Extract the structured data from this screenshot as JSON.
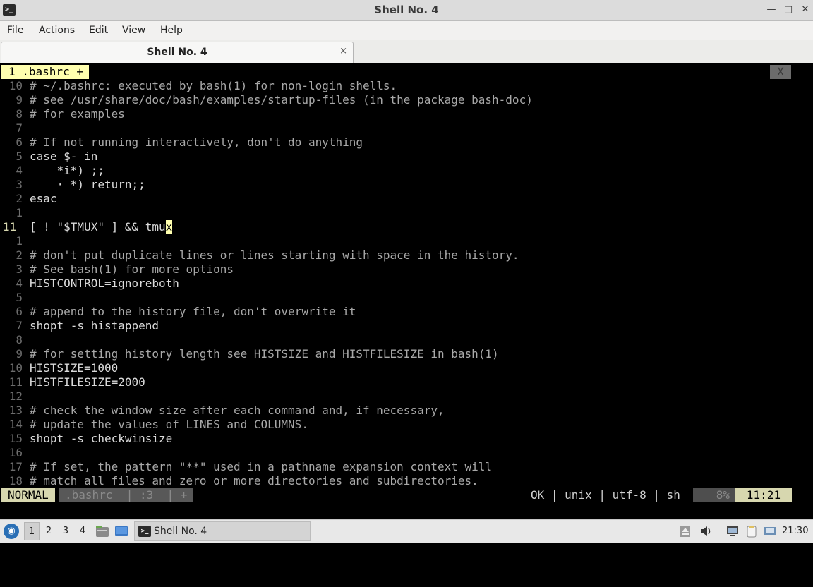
{
  "window": {
    "title": "Shell No. 4",
    "controls": {
      "minimize": "—",
      "maximize": "□",
      "close": "✕"
    }
  },
  "menu": [
    "File",
    "Actions",
    "Edit",
    "View",
    "Help"
  ],
  "tab": {
    "label": "Shell No. 4",
    "close": "×"
  },
  "editor": {
    "buffer_tab": "1 .bashrc +",
    "close_button": "X",
    "lines": [
      {
        "num": "10",
        "text": "# ~/.bashrc: executed by bash(1) for non-login shells.",
        "kind": "comment"
      },
      {
        "num": "9",
        "text": "# see /usr/share/doc/bash/examples/startup-files (in the package bash-doc)",
        "kind": "comment"
      },
      {
        "num": "8",
        "text": "# for examples",
        "kind": "comment"
      },
      {
        "num": "7",
        "text": "",
        "kind": "plain"
      },
      {
        "num": "6",
        "text": "# If not running interactively, don't do anything",
        "kind": "comment"
      },
      {
        "num": "5",
        "text": "case $- in",
        "kind": "plain"
      },
      {
        "num": "4",
        "text": "    *i*) ;;",
        "kind": "plain"
      },
      {
        "num": "3",
        "text": "    · *) return;;",
        "kind": "plain"
      },
      {
        "num": "2",
        "text": "esac",
        "kind": "plain"
      },
      {
        "num": "1",
        "text": "",
        "kind": "plain"
      },
      {
        "num": "11",
        "text": "[ ! \"$TMUX\" ] && tmu",
        "kind": "current",
        "cursor_char": "x"
      },
      {
        "num": "1",
        "text": "",
        "kind": "plain"
      },
      {
        "num": "2",
        "text": "# don't put duplicate lines or lines starting with space in the history.",
        "kind": "comment"
      },
      {
        "num": "3",
        "text": "# See bash(1) for more options",
        "kind": "comment"
      },
      {
        "num": "4",
        "text": "HISTCONTROL=ignoreboth",
        "kind": "plain"
      },
      {
        "num": "5",
        "text": "",
        "kind": "plain"
      },
      {
        "num": "6",
        "text": "# append to the history file, don't overwrite it",
        "kind": "comment"
      },
      {
        "num": "7",
        "text": "shopt -s histappend",
        "kind": "plain"
      },
      {
        "num": "8",
        "text": "",
        "kind": "plain"
      },
      {
        "num": "9",
        "text": "# for setting history length see HISTSIZE and HISTFILESIZE in bash(1)",
        "kind": "comment"
      },
      {
        "num": "10",
        "text": "HISTSIZE=1000",
        "kind": "plain"
      },
      {
        "num": "11",
        "text": "HISTFILESIZE=2000",
        "kind": "plain"
      },
      {
        "num": "12",
        "text": "",
        "kind": "plain"
      },
      {
        "num": "13",
        "text": "# check the window size after each command and, if necessary,",
        "kind": "comment"
      },
      {
        "num": "14",
        "text": "# update the values of LINES and COLUMNS.",
        "kind": "comment"
      },
      {
        "num": "15",
        "text": "shopt -s checkwinsize",
        "kind": "plain"
      },
      {
        "num": "16",
        "text": "",
        "kind": "plain"
      },
      {
        "num": "17",
        "text": "# If set, the pattern \"**\" used in a pathname expansion context will",
        "kind": "comment"
      },
      {
        "num": "18",
        "text": "# match all files and zero or more directories and subdirectories.",
        "kind": "comment"
      }
    ],
    "status": {
      "mode": "NORMAL",
      "file": ".bashrc  | :3  | +",
      "info": "OK | unix | utf-8 | sh",
      "percent": "8%",
      "position": "11:21"
    }
  },
  "taskbar": {
    "start_glyph": "◉",
    "workspaces": [
      "1",
      "2",
      "3",
      "4"
    ],
    "active_workspace": "1",
    "task_icon": ">_",
    "task": "Shell No. 4",
    "clock": "21:30"
  }
}
